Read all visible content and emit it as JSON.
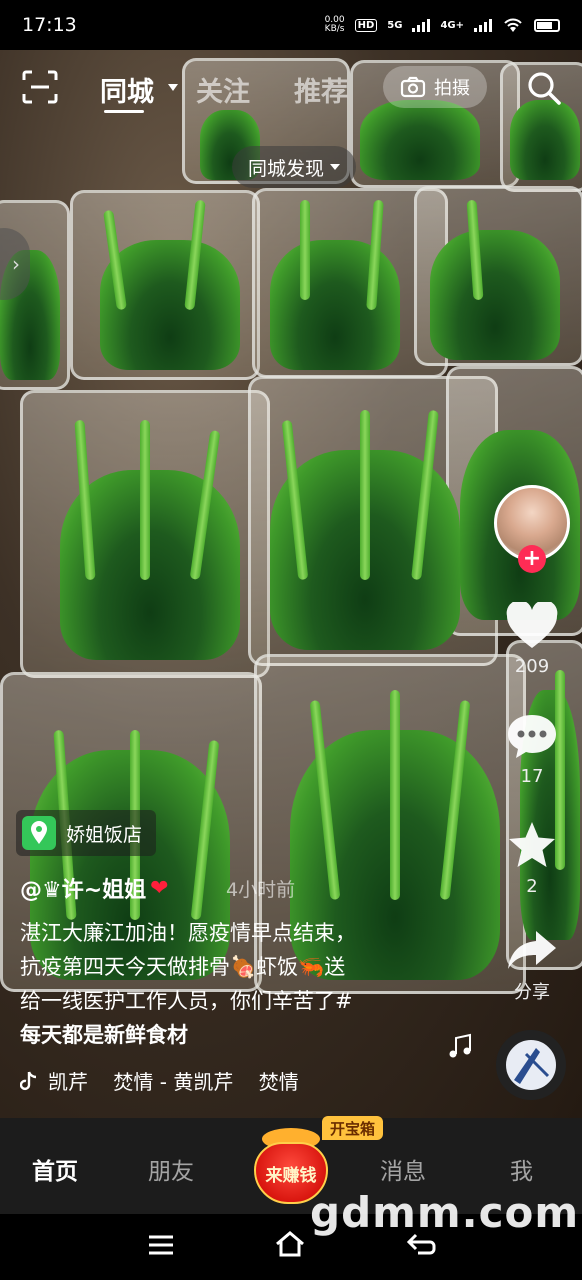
{
  "status_bar": {
    "time": "17:13",
    "net_speed": "0.00\nKB/s",
    "hd": "HD",
    "gen1": "5G",
    "gen2": "4G+"
  },
  "top_nav": {
    "tabs": [
      {
        "label": "同城"
      },
      {
        "label": "关注"
      },
      {
        "label": "推荐"
      }
    ],
    "shoot_label": "拍摄"
  },
  "discover_label": "同城发现",
  "side_rail": {
    "likes": "209",
    "comments": "17",
    "favorites": "2",
    "share_label": "分享"
  },
  "video_info": {
    "poi": "娇姐饭店",
    "author": "@♛许~姐姐",
    "time_ago": "4小时前",
    "caption_line1": "湛江大廉江加油！愿疫情早点结束，",
    "caption_line2": "抗疫第四天今天做排骨🍖虾饭🦐送",
    "caption_line3": "给一线医护工作人员，你们辛苦了#",
    "caption_tag": "每天都是新鲜食材",
    "music": "凯芹    焚情 - 黄凯芹    焚情"
  },
  "bottom_tabs": {
    "home": "首页",
    "friends": "朋友",
    "earn": "来赚钱",
    "treasure": "开宝箱",
    "messages": "消息",
    "me": "我"
  },
  "watermark": "gdmm.com"
}
